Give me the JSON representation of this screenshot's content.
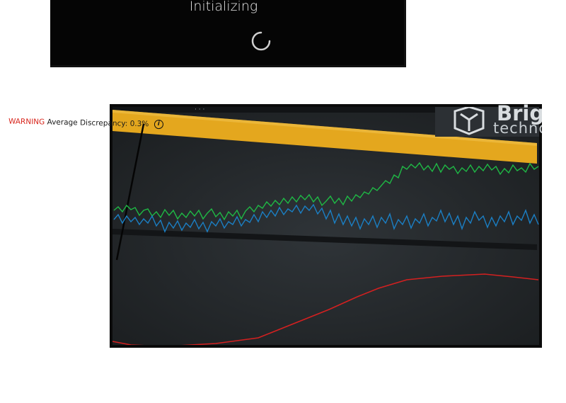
{
  "splash": {
    "status_text": "Initializing"
  },
  "dashboard": {
    "warning_label": "WARNING",
    "warning_message": "Average Discrepancy: 0.3%",
    "info_icon": "info-icon",
    "brand_partial_1": "Brig",
    "brand_partial_2": "techno",
    "colors": {
      "warning_bar": "#e8a91f",
      "warning_text": "#d8261d",
      "series_green": "#1fb845",
      "series_blue": "#1b7fc4",
      "series_red": "#d42020"
    }
  }
}
